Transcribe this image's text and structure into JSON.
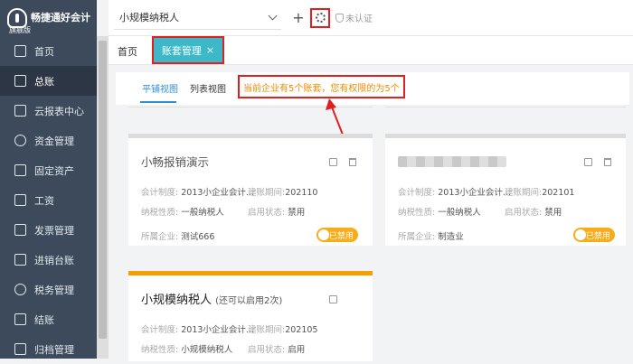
{
  "brand": {
    "name": "畅捷通好会计",
    "edition": "旗舰版"
  },
  "sidebar": {
    "items": [
      {
        "label": "首页",
        "icon": "home-icon"
      },
      {
        "label": "总账",
        "icon": "ledger-icon",
        "active": true
      },
      {
        "label": "云报表中心",
        "icon": "chart-icon"
      },
      {
        "label": "资金管理",
        "icon": "money-icon"
      },
      {
        "label": "固定资产",
        "icon": "asset-icon"
      },
      {
        "label": "工资",
        "icon": "salary-icon"
      },
      {
        "label": "发票管理",
        "icon": "invoice-icon"
      },
      {
        "label": "进销台账",
        "icon": "stock-icon"
      },
      {
        "label": "税务管理",
        "icon": "tax-icon"
      },
      {
        "label": "结账",
        "icon": "close-books-icon"
      },
      {
        "label": "归档管理",
        "icon": "archive-icon"
      }
    ]
  },
  "topbar": {
    "company": "小规模纳税人",
    "plus": "+",
    "unverified": "未认证"
  },
  "tabs": {
    "home": "首页",
    "active": "账套管理",
    "close": "×"
  },
  "viewbar": {
    "tile_view": "平铺视图",
    "list_view": "列表视图",
    "notice": "当前企业有5个账套，您有权限的为5个"
  },
  "cards": [
    {
      "title": "小畅报销演示",
      "acct_system_label": "会计制度:",
      "acct_system": "2013小企业会计...",
      "period_label": "建账期间:",
      "period": "202110",
      "taxpayer_label": "纳税性质:",
      "taxpayer": "一般纳税人",
      "status_label": "启用状态:",
      "status": "禁用",
      "company_label": "所属企业:",
      "company": "测试666",
      "toggle": "已禁用"
    },
    {
      "title": "",
      "acct_system_label": "会计制度:",
      "acct_system": "2013小企业会计...",
      "period_label": "建账期间:",
      "period": "202101",
      "taxpayer_label": "纳税性质:",
      "taxpayer": "一般纳税人",
      "status_label": "启用状态:",
      "status": "禁用",
      "company_label": "所属企业:",
      "company": "制造业",
      "toggle": "已禁用"
    },
    {
      "title": "小规模纳税人",
      "title_sub": "(还可以启用2次)",
      "acct_system_label": "会计制度:",
      "acct_system": "2013小企业会计...",
      "period_label": "建账期间:",
      "period": "202105",
      "taxpayer_label": "纳税性质:",
      "taxpayer": "小规模纳税人",
      "status_label": "启用状态:",
      "status": "启用"
    }
  ],
  "colors": {
    "accent": "#3cb8c8",
    "sidebar": "#3c4a5c",
    "highlight": "#e02020",
    "toggle": "#f7ac1a",
    "notice": "#f08a00"
  }
}
